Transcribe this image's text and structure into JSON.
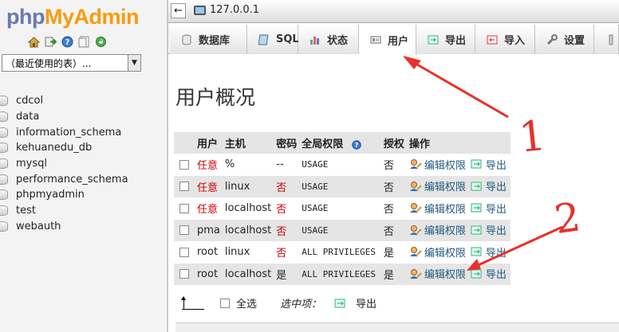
{
  "sidebar": {
    "logo_part1": "php",
    "logo_part2": "MyAdmin",
    "icons": [
      "home-icon",
      "exit-icon",
      "help-icon",
      "docs-icon",
      "reload-icon"
    ],
    "recent_select_value": "（最近使用的表）...",
    "databases": [
      "cdcol",
      "data",
      "information_schema",
      "kehuanedu_db",
      "mysql",
      "performance_schema",
      "phpmyadmin",
      "test",
      "webauth"
    ]
  },
  "topbar": {
    "back_glyph": "←",
    "server": "127.0.0.1"
  },
  "tabs": [
    {
      "label": "数据库",
      "icon": "database-icon"
    },
    {
      "label": "SQL",
      "icon": "sql-icon"
    },
    {
      "label": "状态",
      "icon": "status-icon"
    },
    {
      "label": "用户",
      "icon": "users-icon",
      "active": true
    },
    {
      "label": "导出",
      "icon": "export-icon"
    },
    {
      "label": "导入",
      "icon": "import-icon"
    },
    {
      "label": "设置",
      "icon": "wrench-icon"
    }
  ],
  "page_title": "用户概况",
  "table": {
    "headers": [
      "",
      "用户",
      "主机",
      "密码",
      "全局权限",
      "授权",
      "操作"
    ],
    "rows": [
      {
        "user": "任意",
        "host": "%",
        "password": "--",
        "privileges": "USAGE",
        "grant": "否",
        "edit": "编辑权限",
        "export": "导出"
      },
      {
        "user": "任意",
        "host": "linux",
        "password": "否",
        "privileges": "USAGE",
        "grant": "否",
        "edit": "编辑权限",
        "export": "导出"
      },
      {
        "user": "任意",
        "host": "localhost",
        "password": "否",
        "privileges": "USAGE",
        "grant": "否",
        "edit": "编辑权限",
        "export": "导出"
      },
      {
        "user": "pma",
        "host": "localhost",
        "password": "否",
        "privileges": "USAGE",
        "grant": "否",
        "edit": "编辑权限",
        "export": "导出"
      },
      {
        "user": "root",
        "host": "linux",
        "password": "否",
        "privileges": "ALL PRIVILEGES",
        "grant": "是",
        "edit": "编辑权限",
        "export": "导出"
      },
      {
        "user": "root",
        "host": "localhost",
        "password": "是",
        "privileges": "ALL PRIVILEGES",
        "grant": "是",
        "edit": "编辑权限",
        "export": "导出"
      }
    ]
  },
  "footer": {
    "select_all": "全选",
    "selected_label": "选中项：",
    "export": "导出"
  },
  "annotations": {
    "mark1": "1",
    "mark2": "2",
    "color": "#e8302a"
  },
  "colors": {
    "accent_blue": "#6c78af",
    "accent_orange": "#f89c0e",
    "link": "#235a81",
    "red_text": "#cc0000"
  }
}
